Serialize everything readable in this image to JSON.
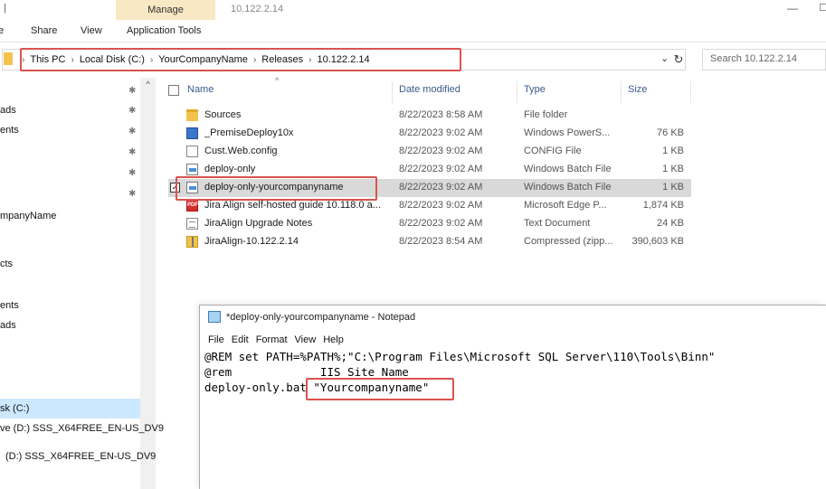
{
  "window": {
    "context_tab": "Manage",
    "context_group": "Application Tools",
    "title": "10.122.2.14",
    "minimize_glyph": "—",
    "restore_glyph": "☐"
  },
  "ribbon": {
    "tabs": [
      "Share",
      "View",
      "Application Tools"
    ]
  },
  "address": {
    "crumbs": [
      "This PC",
      "Local Disk (C:)",
      "YourCompanyName",
      "Releases",
      "10.122.2.14"
    ],
    "search_placeholder": "Search 10.122.2.14"
  },
  "nav": {
    "items": [
      "ads",
      "ents",
      "mpanyName",
      "cts",
      "ents",
      "ads",
      "sk (C:)",
      "ve (D:) SSS_X64FREE_EN-US_DV9",
      "(D:) SSS_X64FREE_EN-US_DV9"
    ]
  },
  "columns": {
    "name": "Name",
    "date": "Date modified",
    "type": "Type",
    "size": "Size"
  },
  "files": [
    {
      "name": "Sources",
      "date": "8/22/2023 8:58 AM",
      "type": "File folder",
      "size": "",
      "icon": "folder-icon"
    },
    {
      "name": "_PremiseDeploy10x",
      "date": "8/22/2023 9:02 AM",
      "type": "Windows PowerS...",
      "size": "76 KB",
      "icon": "powershell-icon"
    },
    {
      "name": "Cust.Web.config",
      "date": "8/22/2023 9:02 AM",
      "type": "CONFIG File",
      "size": "1 KB",
      "icon": "config-file-icon"
    },
    {
      "name": "deploy-only",
      "date": "8/22/2023 9:02 AM",
      "type": "Windows Batch File",
      "size": "1 KB",
      "icon": "batch-file-icon"
    },
    {
      "name": "deploy-only-yourcompanyname",
      "date": "8/22/2023 9:02 AM",
      "type": "Windows Batch File",
      "size": "1 KB",
      "icon": "batch-file-icon"
    },
    {
      "name": "Jira Align self-hosted guide 10.118.0 a...",
      "date": "8/22/2023 9:02 AM",
      "type": "Microsoft Edge P...",
      "size": "1,874 KB",
      "icon": "pdf-icon"
    },
    {
      "name": "JiraAlign Upgrade Notes",
      "date": "8/22/2023 9:02 AM",
      "type": "Text Document",
      "size": "24 KB",
      "icon": "text-document-icon"
    },
    {
      "name": "JiraAlign-10.122.2.14",
      "date": "8/22/2023 8:54 AM",
      "type": "Compressed (zipp...",
      "size": "390,603 KB",
      "icon": "zip-icon"
    }
  ],
  "notepad": {
    "title": "*deploy-only-yourcompanyname - Notepad",
    "menu": [
      "File",
      "Edit",
      "Format",
      "View",
      "Help"
    ],
    "lines": [
      "@REM set PATH=%PATH%;\"C:\\Program Files\\Microsoft SQL Server\\110\\Tools\\Binn\"",
      "@rem             IIS Site Name",
      "deploy-only.bat \"Yourcompanyname\""
    ]
  },
  "colors": {
    "highlight_box": "#d9534f",
    "selected_row": "#d9d9d9",
    "nav_selected": "#cce8ff",
    "manage_tab": "#f8e8c4"
  }
}
